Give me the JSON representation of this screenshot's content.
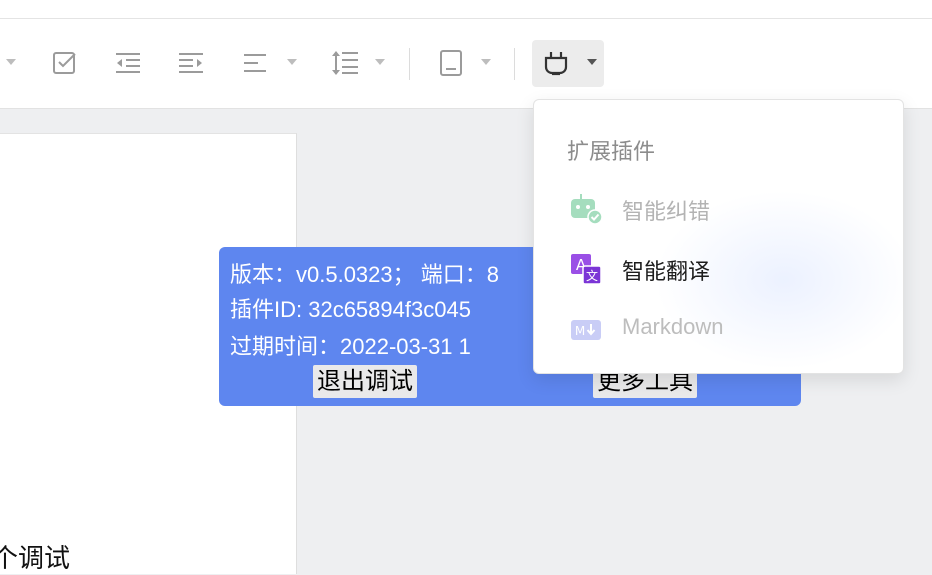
{
  "toolbar": {
    "icons": [
      "task-checkbox-icon",
      "outdent-icon",
      "indent-icon",
      "align-icon",
      "line-height-icon",
      "page-layout-icon",
      "plugin-icon"
    ],
    "plugin_button_active": true
  },
  "document": {
    "text_fragment": "个调试"
  },
  "debug_panel": {
    "line1": "版本：v0.5.0323；  端口：8",
    "line2": "插件ID: 32c65894f3c045",
    "line3": "过期时间：2022-03-31 1",
    "exit_button": "退出调试",
    "more_tools_button": "更多工具",
    "background_color": "#5e86ef"
  },
  "plugin_menu": {
    "title": "扩展插件",
    "items": [
      {
        "label": "智能纠错",
        "icon": "robot-check-icon",
        "enabled": false
      },
      {
        "label": "智能翻译",
        "icon": "translate-icon",
        "enabled": true
      },
      {
        "label": "Markdown",
        "icon": "markdown-icon",
        "enabled": false
      }
    ]
  }
}
